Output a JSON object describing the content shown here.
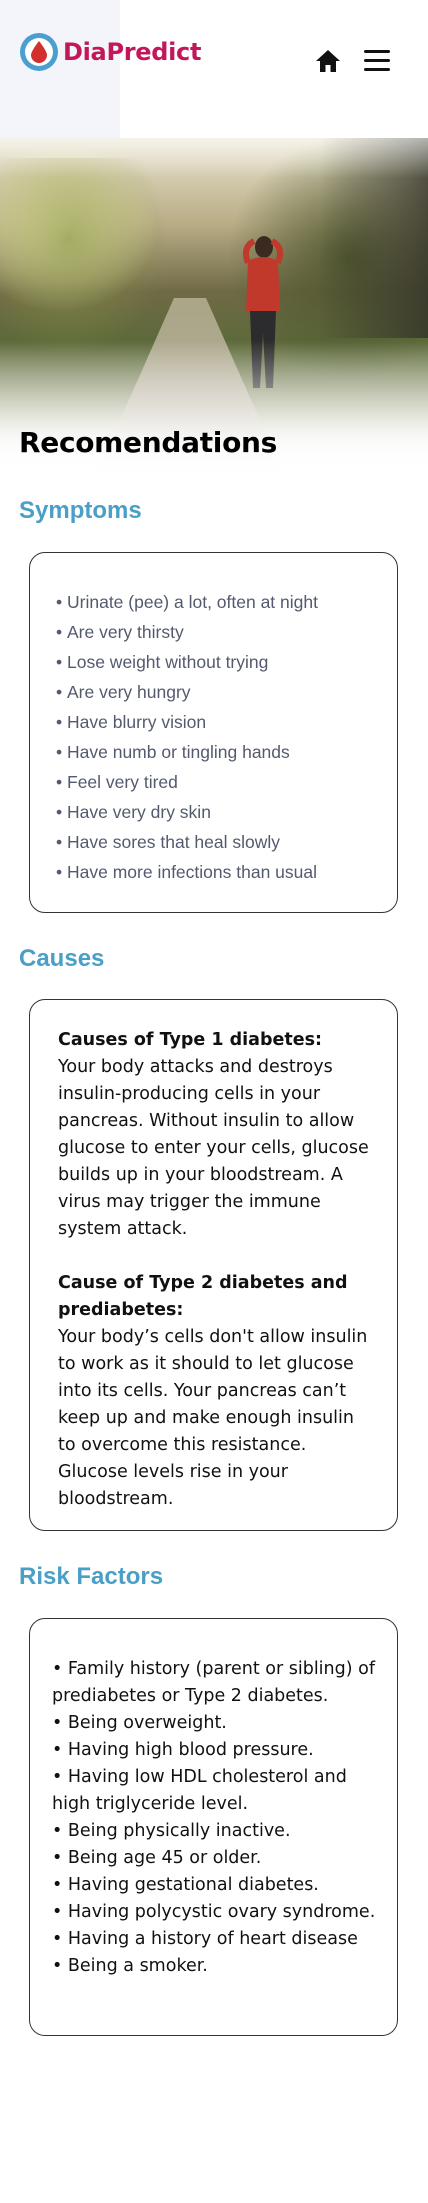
{
  "header": {
    "app_name": "DiaPredict",
    "logo_icon": "blood-drop-icon",
    "home_icon": "home-icon",
    "menu_icon": "hamburger-menu-icon",
    "brand_color": "#c2185b",
    "logo_ring_color": "#4a9fd0"
  },
  "hero": {
    "image": "person-jogging-on-park-path",
    "title": "Recomendations"
  },
  "symptoms": {
    "title": "Symptoms",
    "title_color": "#4a9fc6",
    "bullet": "•",
    "items": [
      "Urinate (pee) a lot, often at night",
      "Are very thirsty",
      "Lose weight without trying",
      "Are very hungry",
      "Have blurry vision",
      "Have numb or tingling hands",
      "Feel very tired",
      "Have very dry skin",
      "Have sores that heal slowly",
      "Have more infections than usual"
    ]
  },
  "causes": {
    "title": "Causes",
    "type1_heading": "Causes of Type 1 diabetes:",
    "type1_text": "Your body attacks and destroys insulin-producing cells in your pancreas. Without insulin to allow glucose to enter your cells, glucose builds up in your bloodstream. A virus may trigger the immune system attack.",
    "type2_heading": "Cause of Type 2 diabetes and prediabetes:",
    "type2_text": "Your body’s cells don't allow insulin to work as it should to let glucose into its cells. Your pancreas can’t keep up and make enough insulin to overcome this resistance. Glucose levels rise in your bloodstream."
  },
  "risk_factors": {
    "title": "Risk Factors",
    "items": [
      "• Family history (parent or sibling) of prediabetes or Type 2 diabetes.",
      "• Being overweight.",
      "• Having high blood pressure.",
      "• Having low HDL cholesterol and high triglyceride level.",
      "• Being physically inactive.",
      "• Being age 45 or older.",
      "• Having gestational diabetes.",
      "• Having polycystic ovary syndrome.",
      "• Having a history of heart disease",
      "• Being a smoker."
    ]
  }
}
